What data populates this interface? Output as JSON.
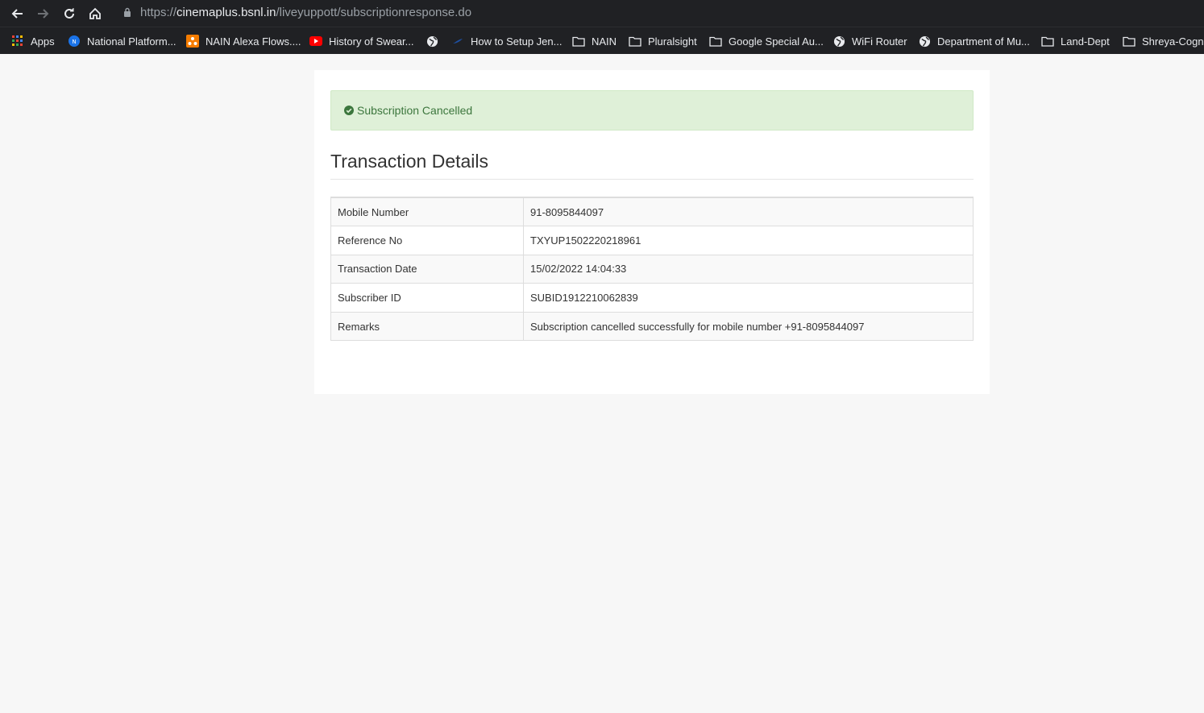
{
  "browser": {
    "url_scheme": "https://",
    "url_host": "cinemaplus.bsnl.in",
    "url_path": "/liveyuppott/subscriptionresponse.do",
    "icons": [
      "back-arrow-icon",
      "forward-arrow-icon",
      "reload-icon",
      "home-icon",
      "lock-icon"
    ]
  },
  "bookmarks": [
    {
      "label": "Apps",
      "icon": "apps-grid-icon"
    },
    {
      "label": "National Platform...",
      "icon": "site-favicon-icon"
    },
    {
      "label": "NAIN Alexa Flows....",
      "icon": "site-favicon-icon"
    },
    {
      "label": "History of Swear...",
      "icon": "youtube-icon"
    },
    {
      "label": "",
      "icon": "globe-icon"
    },
    {
      "label": "How to Setup Jen...",
      "icon": "site-favicon-icon"
    },
    {
      "label": "NAIN",
      "icon": "folder-icon"
    },
    {
      "label": "Pluralsight",
      "icon": "folder-icon"
    },
    {
      "label": "Google Special Au...",
      "icon": "folder-icon"
    },
    {
      "label": "WiFi Router",
      "icon": "globe-icon"
    },
    {
      "label": "Department of Mu...",
      "icon": "globe-icon"
    },
    {
      "label": "Land-Dept",
      "icon": "folder-icon"
    },
    {
      "label": "Shreya-Cogni",
      "icon": "folder-icon"
    }
  ],
  "alert": {
    "text": "Subscription Cancelled",
    "icon": "check-circle-icon",
    "color": "#3c763d",
    "background": "#dff0d8"
  },
  "page": {
    "heading": "Transaction Details"
  },
  "details": [
    {
      "label": "Mobile Number",
      "value": "91-8095844097"
    },
    {
      "label": "Reference No",
      "value": "TXYUP1502220218961"
    },
    {
      "label": "Transaction Date",
      "value": "15/02/2022 14:04:33"
    },
    {
      "label": "Subscriber ID",
      "value": "SUBID1912210062839"
    },
    {
      "label": "Remarks",
      "value": "Subscription cancelled successfully for mobile number +91-8095844097"
    }
  ]
}
